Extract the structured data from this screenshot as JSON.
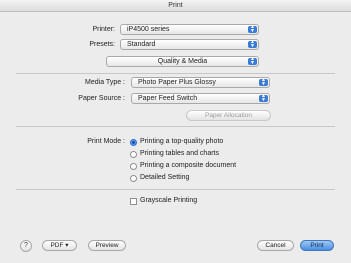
{
  "window": {
    "title": "Print"
  },
  "printer": {
    "label": "Printer:",
    "value": "iP4500 series"
  },
  "presets": {
    "label": "Presets:",
    "value": "Standard"
  },
  "section": {
    "value": "Quality & Media"
  },
  "media_type": {
    "label": "Media Type :",
    "value": "Photo Paper Plus Glossy"
  },
  "paper_source": {
    "label": "Paper Source :",
    "value": "Paper Feed Switch"
  },
  "paper_allocation": {
    "label": "Paper Allocation"
  },
  "print_mode": {
    "label": "Print Mode :",
    "options": [
      {
        "label": "Printing a top-quality photo",
        "selected": true
      },
      {
        "label": "Printing tables and charts",
        "selected": false
      },
      {
        "label": "Printing a composite document",
        "selected": false
      },
      {
        "label": "Detailed Setting",
        "selected": false
      }
    ]
  },
  "grayscale": {
    "label": "Grayscale Printing",
    "checked": false
  },
  "footer": {
    "help_label": "?",
    "pdf_label": "PDF ▾",
    "preview_label": "Preview",
    "cancel_label": "Cancel",
    "print_label": "Print"
  },
  "colors": {
    "accent": "#3a7bd5"
  }
}
